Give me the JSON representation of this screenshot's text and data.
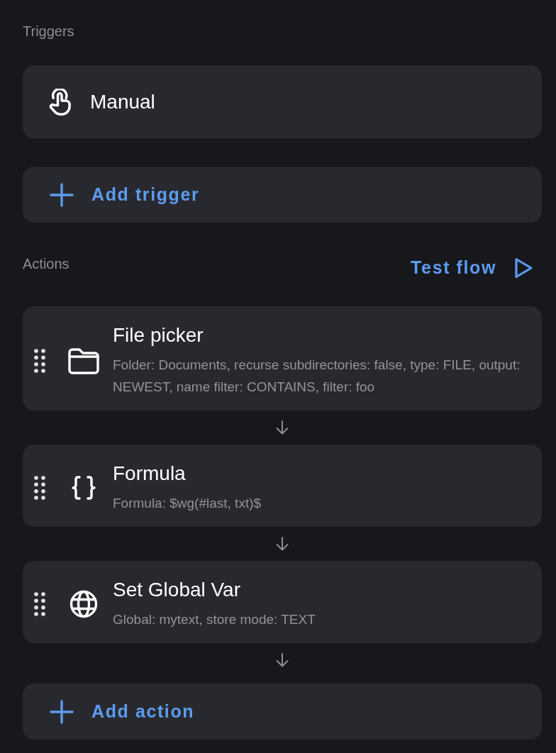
{
  "triggers": {
    "title": "Triggers",
    "items": [
      {
        "kind": "manual",
        "label": "Manual"
      }
    ],
    "add_button": "Add trigger"
  },
  "actions": {
    "title": "Actions",
    "test_button": "Test flow",
    "items": [
      {
        "kind": "filepicker",
        "title": "File picker",
        "description": "Folder: Documents, recurse subdirectories: false, type: FILE, output: NEWEST, name filter: CONTAINS, filter: foo"
      },
      {
        "kind": "formula",
        "title": "Formula",
        "description": "Formula: $wg(#last, txt)$"
      },
      {
        "kind": "globalvar",
        "title": "Set Global Var",
        "description": "Global: mytext, store mode: TEXT"
      }
    ],
    "add_button": "Add action"
  }
}
